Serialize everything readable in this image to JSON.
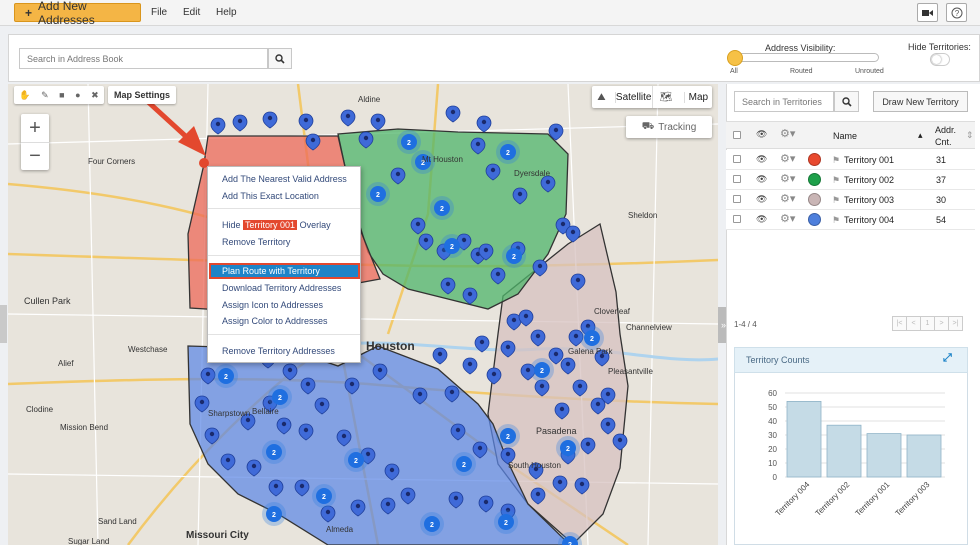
{
  "toolbar": {
    "add_addresses": "Add New Addresses",
    "menu": [
      "File",
      "Edit",
      "Help"
    ]
  },
  "search": {
    "placeholder": "Search in Address Book"
  },
  "visibility": {
    "label": "Address Visibility:",
    "ticks": [
      "All",
      "Routed",
      "Unrouted"
    ],
    "level": 0,
    "hide_territories_label": "Hide Territories:"
  },
  "map": {
    "settings_label": "Map Settings",
    "satellite_label": "Satellite",
    "map_label": "Map",
    "tracking_label": "Tracking",
    "zoom_in": "+",
    "zoom_out": "−",
    "place_labels": [
      "Houston",
      "Pasadena",
      "Mt Houston",
      "Bellaire",
      "Missouri City",
      "Cullen Park",
      "Clodine",
      "Mission Bend",
      "South Houston",
      "Sheldon",
      "Cloverleaf",
      "Channelview",
      "Aldine",
      "Alief",
      "Sharpstown",
      "Westchase",
      "Galena Park",
      "Almeda",
      "Sand Land",
      "Dyersdale",
      "Four Corners",
      "Pleasantville",
      "Sugar Land"
    ]
  },
  "context_menu": {
    "items": [
      "Add The Nearest Valid Address",
      "Add This Exact Location",
      "Hide",
      "Territory 001",
      "Overlay",
      "Remove Territory",
      "Plan Route with Territory",
      "Download Territory Addresses",
      "Assign Icon to Addresses",
      "Assign Color to Addresses",
      "Remove Territory Addresses"
    ]
  },
  "territories": {
    "search_placeholder": "Search in Territories",
    "draw_button": "Draw New Territory",
    "col_name": "Name",
    "col_count": "Addr. Cnt.",
    "rows": [
      {
        "name": "Territory 001",
        "count": "31",
        "color": "#e8492f"
      },
      {
        "name": "Territory 002",
        "count": "37",
        "color": "#1ea04a"
      },
      {
        "name": "Territory 003",
        "count": "30",
        "color": "#c9b5b5"
      },
      {
        "name": "Territory 004",
        "count": "54",
        "color": "#4e7fdc"
      }
    ],
    "pager_info": "1-4 / 4",
    "pager_buttons": [
      "|<",
      "<",
      "1",
      ">",
      ">|"
    ]
  },
  "counts": {
    "title": "Territory Counts",
    "chart_data": {
      "type": "bar",
      "categories": [
        "Territory 004",
        "Territory 002",
        "Territory 001",
        "Territory 003"
      ],
      "values": [
        54,
        37,
        31,
        30
      ],
      "ylim": [
        0,
        60
      ],
      "yticks": [
        0,
        10,
        20,
        30,
        40,
        50,
        60
      ]
    }
  },
  "colors": {
    "accent": "#f4b545",
    "highlight": "#1e84c8",
    "annotation": "#e3482e"
  }
}
